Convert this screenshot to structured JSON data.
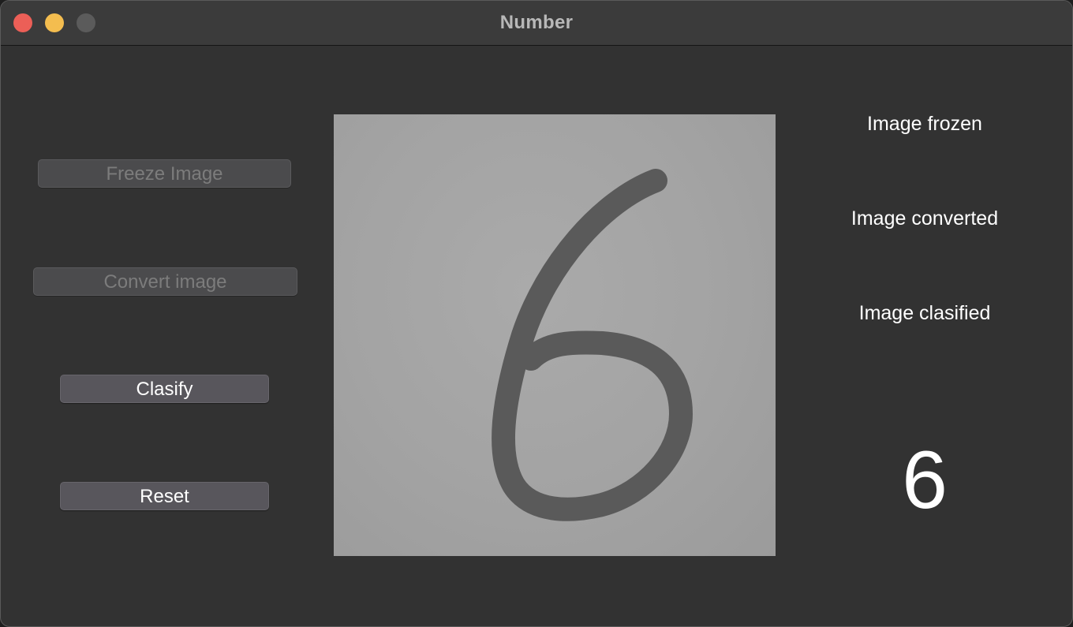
{
  "window": {
    "title": "Number"
  },
  "buttons": {
    "freeze": "Freeze Image",
    "convert": "Convert image",
    "classify": "Clasify",
    "reset": "Reset"
  },
  "status": {
    "frozen": "Image frozen",
    "converted": "Image converted",
    "classified": "Image clasified"
  },
  "result": {
    "digit": "6"
  }
}
